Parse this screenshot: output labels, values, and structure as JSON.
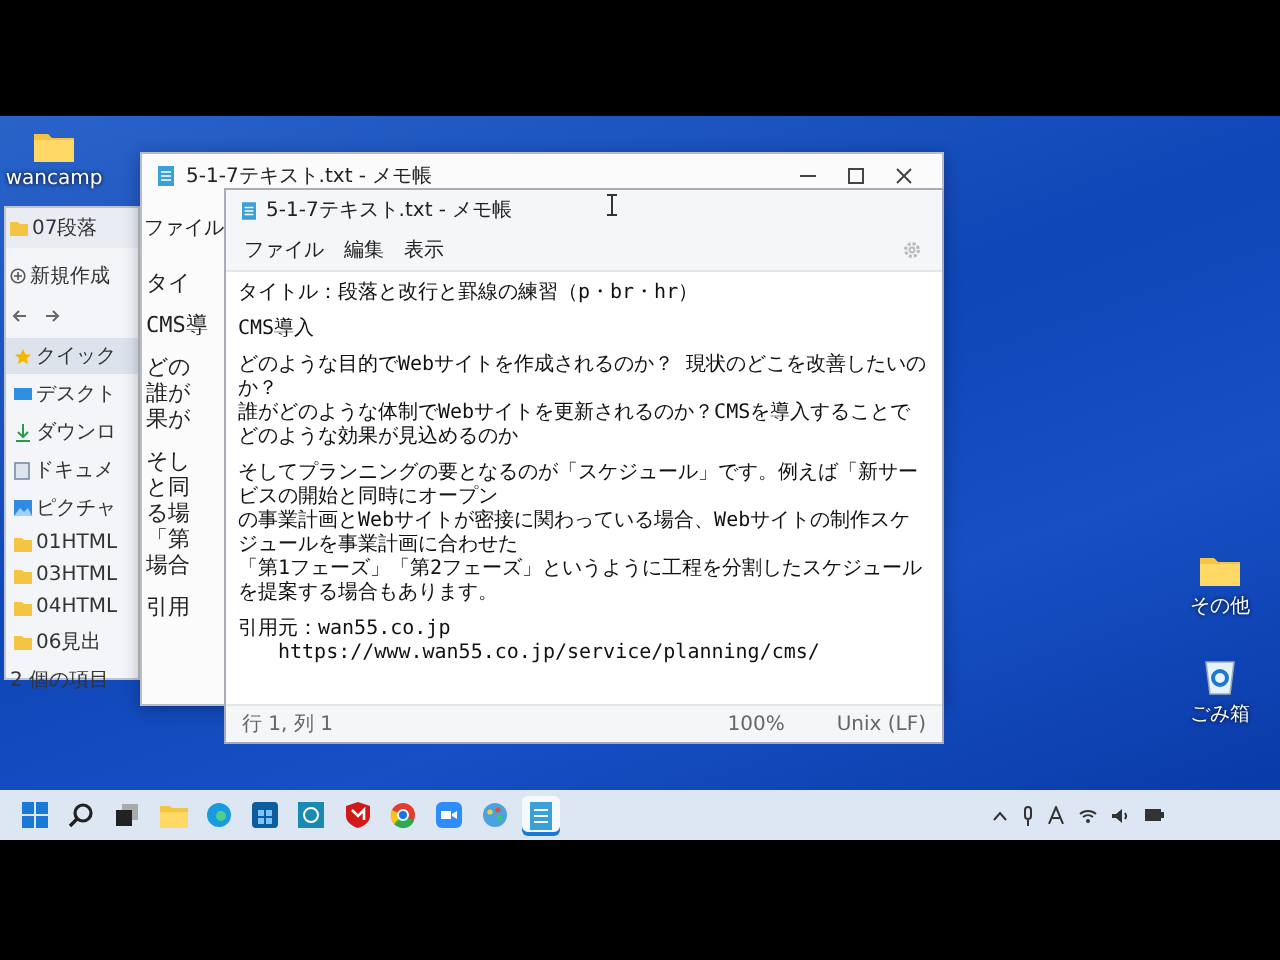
{
  "desktop_icons": [
    {
      "label": "wancamp",
      "kind": "folder"
    },
    {
      "label": "その他",
      "kind": "folder"
    },
    {
      "label": "ごみ箱",
      "kind": "recycle-bin"
    }
  ],
  "explorer": {
    "title": "07段落",
    "toolbar_button": "新規作成",
    "sidebar": [
      {
        "label": "クイック",
        "kind": "star",
        "selected": true
      },
      {
        "label": "デスクト",
        "kind": "desktop",
        "selected": false
      },
      {
        "label": "ダウンロ",
        "kind": "download",
        "selected": false
      },
      {
        "label": "ドキュメ",
        "kind": "document",
        "selected": false
      },
      {
        "label": "ピクチャ",
        "kind": "picture",
        "selected": false
      },
      {
        "label": "01HTML",
        "kind": "folder",
        "selected": false
      },
      {
        "label": "03HTML",
        "kind": "folder",
        "selected": false
      },
      {
        "label": "04HTML",
        "kind": "folder",
        "selected": false
      },
      {
        "label": "06見出",
        "kind": "folder",
        "selected": false
      }
    ],
    "status": "2 個の項目"
  },
  "back_notepad": {
    "title": "5-1-7テキスト.txt - メモ帳",
    "menu": "ファイル",
    "lines": [
      [
        "タイ"
      ],
      [
        "CMS導"
      ],
      [
        "どの",
        "誰が",
        "果が"
      ],
      [
        "そし",
        "と同",
        "る場",
        "「第",
        "場合"
      ],
      [
        "引用"
      ]
    ]
  },
  "notepad": {
    "title": "5-1-7テキスト.txt - メモ帳",
    "menu": [
      "ファイル",
      "編集",
      "表示"
    ],
    "paragraphs": [
      [
        "タイトル：段落と改行と罫線の練習（p・br・hr）"
      ],
      [
        "CMS導入"
      ],
      [
        "どのような目的でWebサイトを作成されるのか？ 現状のどこを改善したいのか？",
        "誰がどのような体制でWebサイトを更新されるのか？CMSを導入することでどのような効果が見込めるのか"
      ],
      [
        "そしてプランニングの要となるのが「スケジュール」です。例えば「新サービスの開始と同時にオープン",
        "の事業計画とWebサイトが密接に関わっている場合、Webサイトの制作スケジュールを事業計画に合わせた",
        "「第1フェーズ」「第2フェーズ」というように工程を分割したスケジュールを提案する場合もあります。"
      ],
      [
        "引用元：wan55.co.jp",
        "　　https://www.wan55.co.jp/service/planning/cms/"
      ]
    ],
    "status": [
      "行 1, 列 1",
      "100%",
      "Unix (LF)"
    ]
  },
  "taskbar": {
    "apps": [
      {
        "kind": "start",
        "selected": false
      },
      {
        "kind": "search",
        "selected": false
      },
      {
        "kind": "taskview",
        "selected": false
      },
      {
        "kind": "folder",
        "selected": false
      },
      {
        "kind": "browser",
        "selected": false
      },
      {
        "kind": "store",
        "selected": false
      },
      {
        "kind": "app",
        "selected": false
      },
      {
        "kind": "shield",
        "selected": false
      },
      {
        "kind": "globe",
        "selected": false
      },
      {
        "kind": "camera",
        "selected": false
      },
      {
        "kind": "paint",
        "selected": false
      },
      {
        "kind": "notepad",
        "selected": true
      }
    ]
  }
}
